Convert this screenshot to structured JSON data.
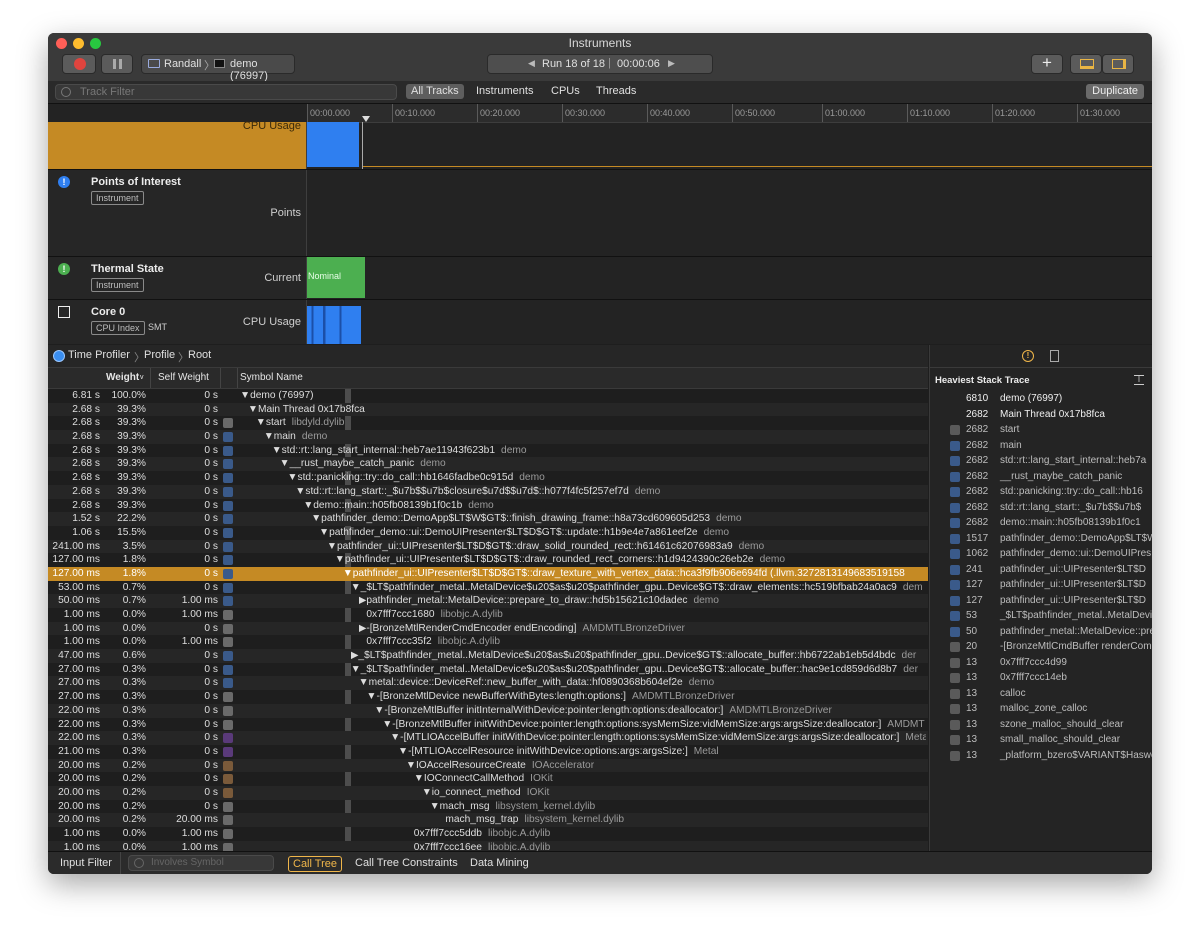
{
  "window": {
    "title": "Instruments"
  },
  "toolbar": {
    "target_device": "Randall",
    "target_process": "demo (76997)",
    "run_label": "Run 18 of 18",
    "run_time": "00:00:06"
  },
  "filter": {
    "placeholder": "Track Filter",
    "tabs": [
      "All Tracks",
      "Instruments",
      "CPUs",
      "Threads"
    ],
    "duplicate_label": "Duplicate"
  },
  "ruler": [
    "00:00.000",
    "00:10.000",
    "00:20.000",
    "00:30.000",
    "00:40.000",
    "00:50.000",
    "01:00.000",
    "01:10.000",
    "01:20.000",
    "01:30.000"
  ],
  "tracks": {
    "cpu_usage": {
      "sub": "CPU Usage"
    },
    "poi": {
      "name": "Points of Interest",
      "pill": "Instrument",
      "sub": "Points"
    },
    "thermal": {
      "name": "Thermal State",
      "pill": "Instrument",
      "sub": "Current",
      "state": "Nominal"
    },
    "core0": {
      "name": "Core 0",
      "pill": "CPU Index",
      "extra": "SMT",
      "sub": "CPU Usage"
    }
  },
  "breadcrumb": [
    "Time Profiler",
    "Profile",
    "Root"
  ],
  "columns": {
    "weight": "Weight",
    "self": "Self Weight",
    "symbol": "Symbol Name"
  },
  "rows": [
    {
      "w": "6.81 s",
      "p": "100.0%",
      "s": "0 s",
      "n": "▼demo (76997)",
      "lib": "",
      "d": 0,
      "icon": "none"
    },
    {
      "w": "2.68 s",
      "p": "39.3%",
      "s": "0 s",
      "n": "▼Main Thread  0x17b8fca",
      "lib": "",
      "d": 1,
      "icon": "none"
    },
    {
      "w": "2.68 s",
      "p": "39.3%",
      "s": "0 s",
      "n": "▼start",
      "lib": "libdyld.dylib",
      "d": 2,
      "icon": "lib"
    },
    {
      "w": "2.68 s",
      "p": "39.3%",
      "s": "0 s",
      "n": "▼main",
      "lib": "demo",
      "d": 3,
      "icon": "user"
    },
    {
      "w": "2.68 s",
      "p": "39.3%",
      "s": "0 s",
      "n": "▼std::rt::lang_start_internal::heb7ae11943f623b1",
      "lib": "demo",
      "d": 4,
      "icon": "user"
    },
    {
      "w": "2.68 s",
      "p": "39.3%",
      "s": "0 s",
      "n": "▼__rust_maybe_catch_panic",
      "lib": "demo",
      "d": 5,
      "icon": "user"
    },
    {
      "w": "2.68 s",
      "p": "39.3%",
      "s": "0 s",
      "n": "▼std::panicking::try::do_call::hb1646fadbe0c915d",
      "lib": "demo",
      "d": 6,
      "icon": "user"
    },
    {
      "w": "2.68 s",
      "p": "39.3%",
      "s": "0 s",
      "n": "▼std::rt::lang_start::_$u7b$$u7b$closure$u7d$$u7d$::h077f4fc5f257ef7d",
      "lib": "demo",
      "d": 7,
      "icon": "user"
    },
    {
      "w": "2.68 s",
      "p": "39.3%",
      "s": "0 s",
      "n": "▼demo::main::h05fb08139b1f0c1b",
      "lib": "demo",
      "d": 8,
      "icon": "user"
    },
    {
      "w": "1.52 s",
      "p": "22.2%",
      "s": "0 s",
      "n": "▼pathfinder_demo::DemoApp$LT$W$GT$::finish_drawing_frame::h8a73cd609605d253",
      "lib": "demo",
      "d": 9,
      "icon": "user"
    },
    {
      "w": "1.06 s",
      "p": "15.5%",
      "s": "0 s",
      "n": "▼pathfinder_demo::ui::DemoUIPresenter$LT$D$GT$::update::h1b9e4e7a861eef2e",
      "lib": "demo",
      "d": 10,
      "icon": "user"
    },
    {
      "w": "241.00 ms",
      "p": "3.5%",
      "s": "0 s",
      "n": "▼pathfinder_ui::UIPresenter$LT$D$GT$::draw_solid_rounded_rect::h61461c62076983a9",
      "lib": "demo",
      "d": 11,
      "icon": "user"
    },
    {
      "w": "127.00 ms",
      "p": "1.8%",
      "s": "0 s",
      "n": "▼pathfinder_ui::UIPresenter$LT$D$GT$::draw_rounded_rect_corners::h1d9424390c26eb2e",
      "lib": "demo",
      "d": 12,
      "icon": "user"
    },
    {
      "w": "127.00 ms",
      "p": "1.8%",
      "s": "0 s",
      "n": "▼pathfinder_ui::UIPresenter$LT$D$GT$::draw_texture_with_vertex_data::hca3f9fb906e694fd (.llvm.3272813149683519158",
      "lib": "",
      "d": 13,
      "icon": "user",
      "sel": true
    },
    {
      "w": "53.00 ms",
      "p": "0.7%",
      "s": "0 s",
      "n": "▼_$LT$pathfinder_metal..MetalDevice$u20$as$u20$pathfinder_gpu..Device$GT$::draw_elements::hc519bfbab24a0ac9",
      "lib": "dem",
      "d": 14,
      "icon": "user"
    },
    {
      "w": "50.00 ms",
      "p": "0.7%",
      "s": "1.00 ms",
      "n": "▶pathfinder_metal::MetalDevice::prepare_to_draw::hd5b15621c10dadec",
      "lib": "demo",
      "d": 15,
      "icon": "user"
    },
    {
      "w": "1.00 ms",
      "p": "0.0%",
      "s": "1.00 ms",
      "n": "0x7fff7ccc1680",
      "lib": "libobjc.A.dylib",
      "d": 16,
      "icon": "lib"
    },
    {
      "w": "1.00 ms",
      "p": "0.0%",
      "s": "0 s",
      "n": "▶-[BronzeMtlRenderCmdEncoder endEncoding]",
      "lib": "AMDMTLBronzeDriver",
      "d": 15,
      "icon": "lib"
    },
    {
      "w": "1.00 ms",
      "p": "0.0%",
      "s": "1.00 ms",
      "n": "0x7fff7ccc35f2",
      "lib": "libobjc.A.dylib",
      "d": 16,
      "icon": "lib"
    },
    {
      "w": "47.00 ms",
      "p": "0.6%",
      "s": "0 s",
      "n": "▶_$LT$pathfinder_metal..MetalDevice$u20$as$u20$pathfinder_gpu..Device$GT$::allocate_buffer::hb6722ab1eb5d4bdc",
      "lib": "der",
      "d": 14,
      "icon": "user"
    },
    {
      "w": "27.00 ms",
      "p": "0.3%",
      "s": "0 s",
      "n": "▼_$LT$pathfinder_metal..MetalDevice$u20$as$u20$pathfinder_gpu..Device$GT$::allocate_buffer::hac9e1cd859d6d8b7",
      "lib": "der",
      "d": 14,
      "icon": "user"
    },
    {
      "w": "27.00 ms",
      "p": "0.3%",
      "s": "0 s",
      "n": "▼metal::device::DeviceRef::new_buffer_with_data::hf0890368b604ef2e",
      "lib": "demo",
      "d": 15,
      "icon": "user"
    },
    {
      "w": "27.00 ms",
      "p": "0.3%",
      "s": "0 s",
      "n": "▼-[BronzeMtlDevice newBufferWithBytes:length:options:]",
      "lib": "AMDMTLBronzeDriver",
      "d": 16,
      "icon": "lib"
    },
    {
      "w": "22.00 ms",
      "p": "0.3%",
      "s": "0 s",
      "n": "▼-[BronzeMtlBuffer initInternalWithDevice:pointer:length:options:deallocator:]",
      "lib": "AMDMTLBronzeDriver",
      "d": 17,
      "icon": "lib"
    },
    {
      "w": "22.00 ms",
      "p": "0.3%",
      "s": "0 s",
      "n": "▼-[BronzeMtlBuffer initWithDevice:pointer:length:options:sysMemSize:vidMemSize:args:argsSize:deallocator:]",
      "lib": "AMDMT",
      "d": 18,
      "icon": "lib"
    },
    {
      "w": "22.00 ms",
      "p": "0.3%",
      "s": "0 s",
      "n": "▼-[MTLIOAccelBuffer initWithDevice:pointer:length:options:sysMemSize:vidMemSize:args:argsSize:deallocator:]",
      "lib": "Meta",
      "d": 19,
      "icon": "metal"
    },
    {
      "w": "21.00 ms",
      "p": "0.3%",
      "s": "0 s",
      "n": "▼-[MTLIOAccelResource initWithDevice:options:args:argsSize:]",
      "lib": "Metal",
      "d": 20,
      "icon": "metal"
    },
    {
      "w": "20.00 ms",
      "p": "0.2%",
      "s": "0 s",
      "n": "▼IOAccelResourceCreate",
      "lib": "IOAccelerator",
      "d": 21,
      "icon": "sys"
    },
    {
      "w": "20.00 ms",
      "p": "0.2%",
      "s": "0 s",
      "n": "▼IOConnectCallMethod",
      "lib": "IOKit",
      "d": 22,
      "icon": "sys"
    },
    {
      "w": "20.00 ms",
      "p": "0.2%",
      "s": "0 s",
      "n": "▼io_connect_method",
      "lib": "IOKit",
      "d": 23,
      "icon": "sys"
    },
    {
      "w": "20.00 ms",
      "p": "0.2%",
      "s": "0 s",
      "n": "▼mach_msg",
      "lib": "libsystem_kernel.dylib",
      "d": 24,
      "icon": "lib"
    },
    {
      "w": "20.00 ms",
      "p": "0.2%",
      "s": "20.00 ms",
      "n": "mach_msg_trap",
      "lib": "libsystem_kernel.dylib",
      "d": 26,
      "icon": "lib"
    },
    {
      "w": "1.00 ms",
      "p": "0.0%",
      "s": "1.00 ms",
      "n": "0x7fff7ccc5ddb",
      "lib": "libobjc.A.dylib",
      "d": 22,
      "icon": "lib"
    },
    {
      "w": "1.00 ms",
      "p": "0.0%",
      "s": "1.00 ms",
      "n": "0x7fff7ccc16ee",
      "lib": "libobjc.A.dylib",
      "d": 22,
      "icon": "lib"
    }
  ],
  "heaviest": {
    "title": "Heaviest Stack Trace",
    "items": [
      {
        "c": "6810",
        "n": "demo (76997)",
        "icon": "none",
        "strong": true
      },
      {
        "c": "2682",
        "n": "Main Thread  0x17b8fca",
        "icon": "none",
        "strong": true
      },
      {
        "c": "2682",
        "n": "start",
        "icon": "lib"
      },
      {
        "c": "2682",
        "n": "main",
        "icon": "user"
      },
      {
        "c": "2682",
        "n": "std::rt::lang_start_internal::heb7a",
        "icon": "user"
      },
      {
        "c": "2682",
        "n": "__rust_maybe_catch_panic",
        "icon": "user"
      },
      {
        "c": "2682",
        "n": "std::panicking::try::do_call::hb16",
        "icon": "user"
      },
      {
        "c": "2682",
        "n": "std::rt::lang_start::_$u7b$$u7b$",
        "icon": "user"
      },
      {
        "c": "2682",
        "n": "demo::main::h05fb08139b1f0c1",
        "icon": "user"
      },
      {
        "c": "1517",
        "n": "pathfinder_demo::DemoApp$LT$W",
        "icon": "user"
      },
      {
        "c": "1062",
        "n": "pathfinder_demo::ui::DemoUIPres",
        "icon": "user"
      },
      {
        "c": "241",
        "n": "pathfinder_ui::UIPresenter$LT$D",
        "icon": "user"
      },
      {
        "c": "127",
        "n": "pathfinder_ui::UIPresenter$LT$D",
        "icon": "user"
      },
      {
        "c": "127",
        "n": "pathfinder_ui::UIPresenter$LT$D",
        "icon": "user"
      },
      {
        "c": "53",
        "n": "_$LT$pathfinder_metal..MetalDevic",
        "icon": "user"
      },
      {
        "c": "50",
        "n": "pathfinder_metal::MetalDevice::pre",
        "icon": "user"
      },
      {
        "c": "20",
        "n": "-[BronzeMtlCmdBuffer renderComr",
        "icon": "lib"
      },
      {
        "c": "13",
        "n": "0x7fff7ccc4d99",
        "icon": "lib"
      },
      {
        "c": "13",
        "n": "0x7fff7ccc14eb",
        "icon": "lib"
      },
      {
        "c": "13",
        "n": "calloc",
        "icon": "lib"
      },
      {
        "c": "13",
        "n": "malloc_zone_calloc",
        "icon": "lib"
      },
      {
        "c": "13",
        "n": "szone_malloc_should_clear",
        "icon": "lib"
      },
      {
        "c": "13",
        "n": "small_malloc_should_clear",
        "icon": "lib"
      },
      {
        "c": "13",
        "n": "_platform_bzero$VARIANT$Haswel",
        "icon": "lib"
      }
    ]
  },
  "footer": {
    "input_filter": "Input Filter",
    "search_placeholder": "Involves Symbol",
    "tabs": [
      "Call Tree",
      "Call Tree Constraints",
      "Data Mining"
    ]
  },
  "colors": {
    "accent": "#c58a24",
    "cpu_blue": "#2f7ff0",
    "thermal_green": "#4caf50",
    "record_red": "#e0443e"
  }
}
